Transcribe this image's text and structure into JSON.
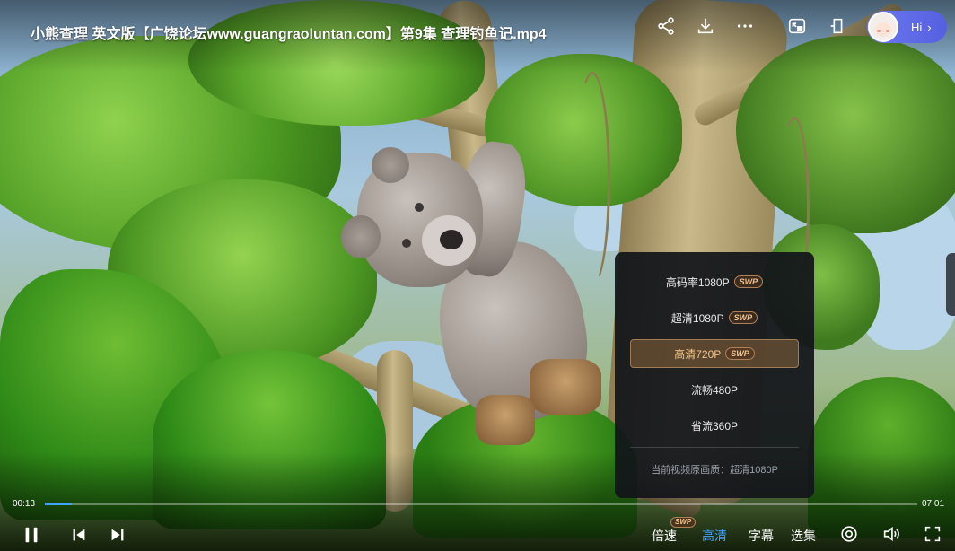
{
  "video": {
    "title": "小熊查理 英文版【广饶论坛www.guangraoluntan.com】第9集 查理钓鱼记.mp4",
    "current_time": "00:13",
    "duration": "07:01",
    "progress": 0.031
  },
  "top_actions": [
    {
      "name": "share-icon"
    },
    {
      "name": "download-icon"
    },
    {
      "name": "more-icon"
    },
    {
      "name": "picture-in-picture-icon"
    },
    {
      "name": "pin-window-icon"
    }
  ],
  "assistant": {
    "label": "Hi",
    "chevron": "›"
  },
  "quality_menu": {
    "items": [
      {
        "label": "高码率1080P",
        "badge": "SWP",
        "active": false
      },
      {
        "label": "超清1080P",
        "badge": "SWP",
        "active": false
      },
      {
        "label": "高清720P",
        "badge": "SWP",
        "active": true
      },
      {
        "label": "流畅480P",
        "badge": "",
        "active": false
      },
      {
        "label": "省流360P",
        "badge": "",
        "active": false
      }
    ],
    "footer": "当前视频原画质：超清1080P"
  },
  "controls": {
    "speed_label": "倍速",
    "speed_badge": "SWP",
    "quality_label": "高清",
    "subtitle_label": "字幕",
    "episodes_label": "选集"
  },
  "colors": {
    "accent": "#3fa3ff",
    "active_quality": "#f3c48a",
    "assistant_pill": "#6d78f0"
  }
}
